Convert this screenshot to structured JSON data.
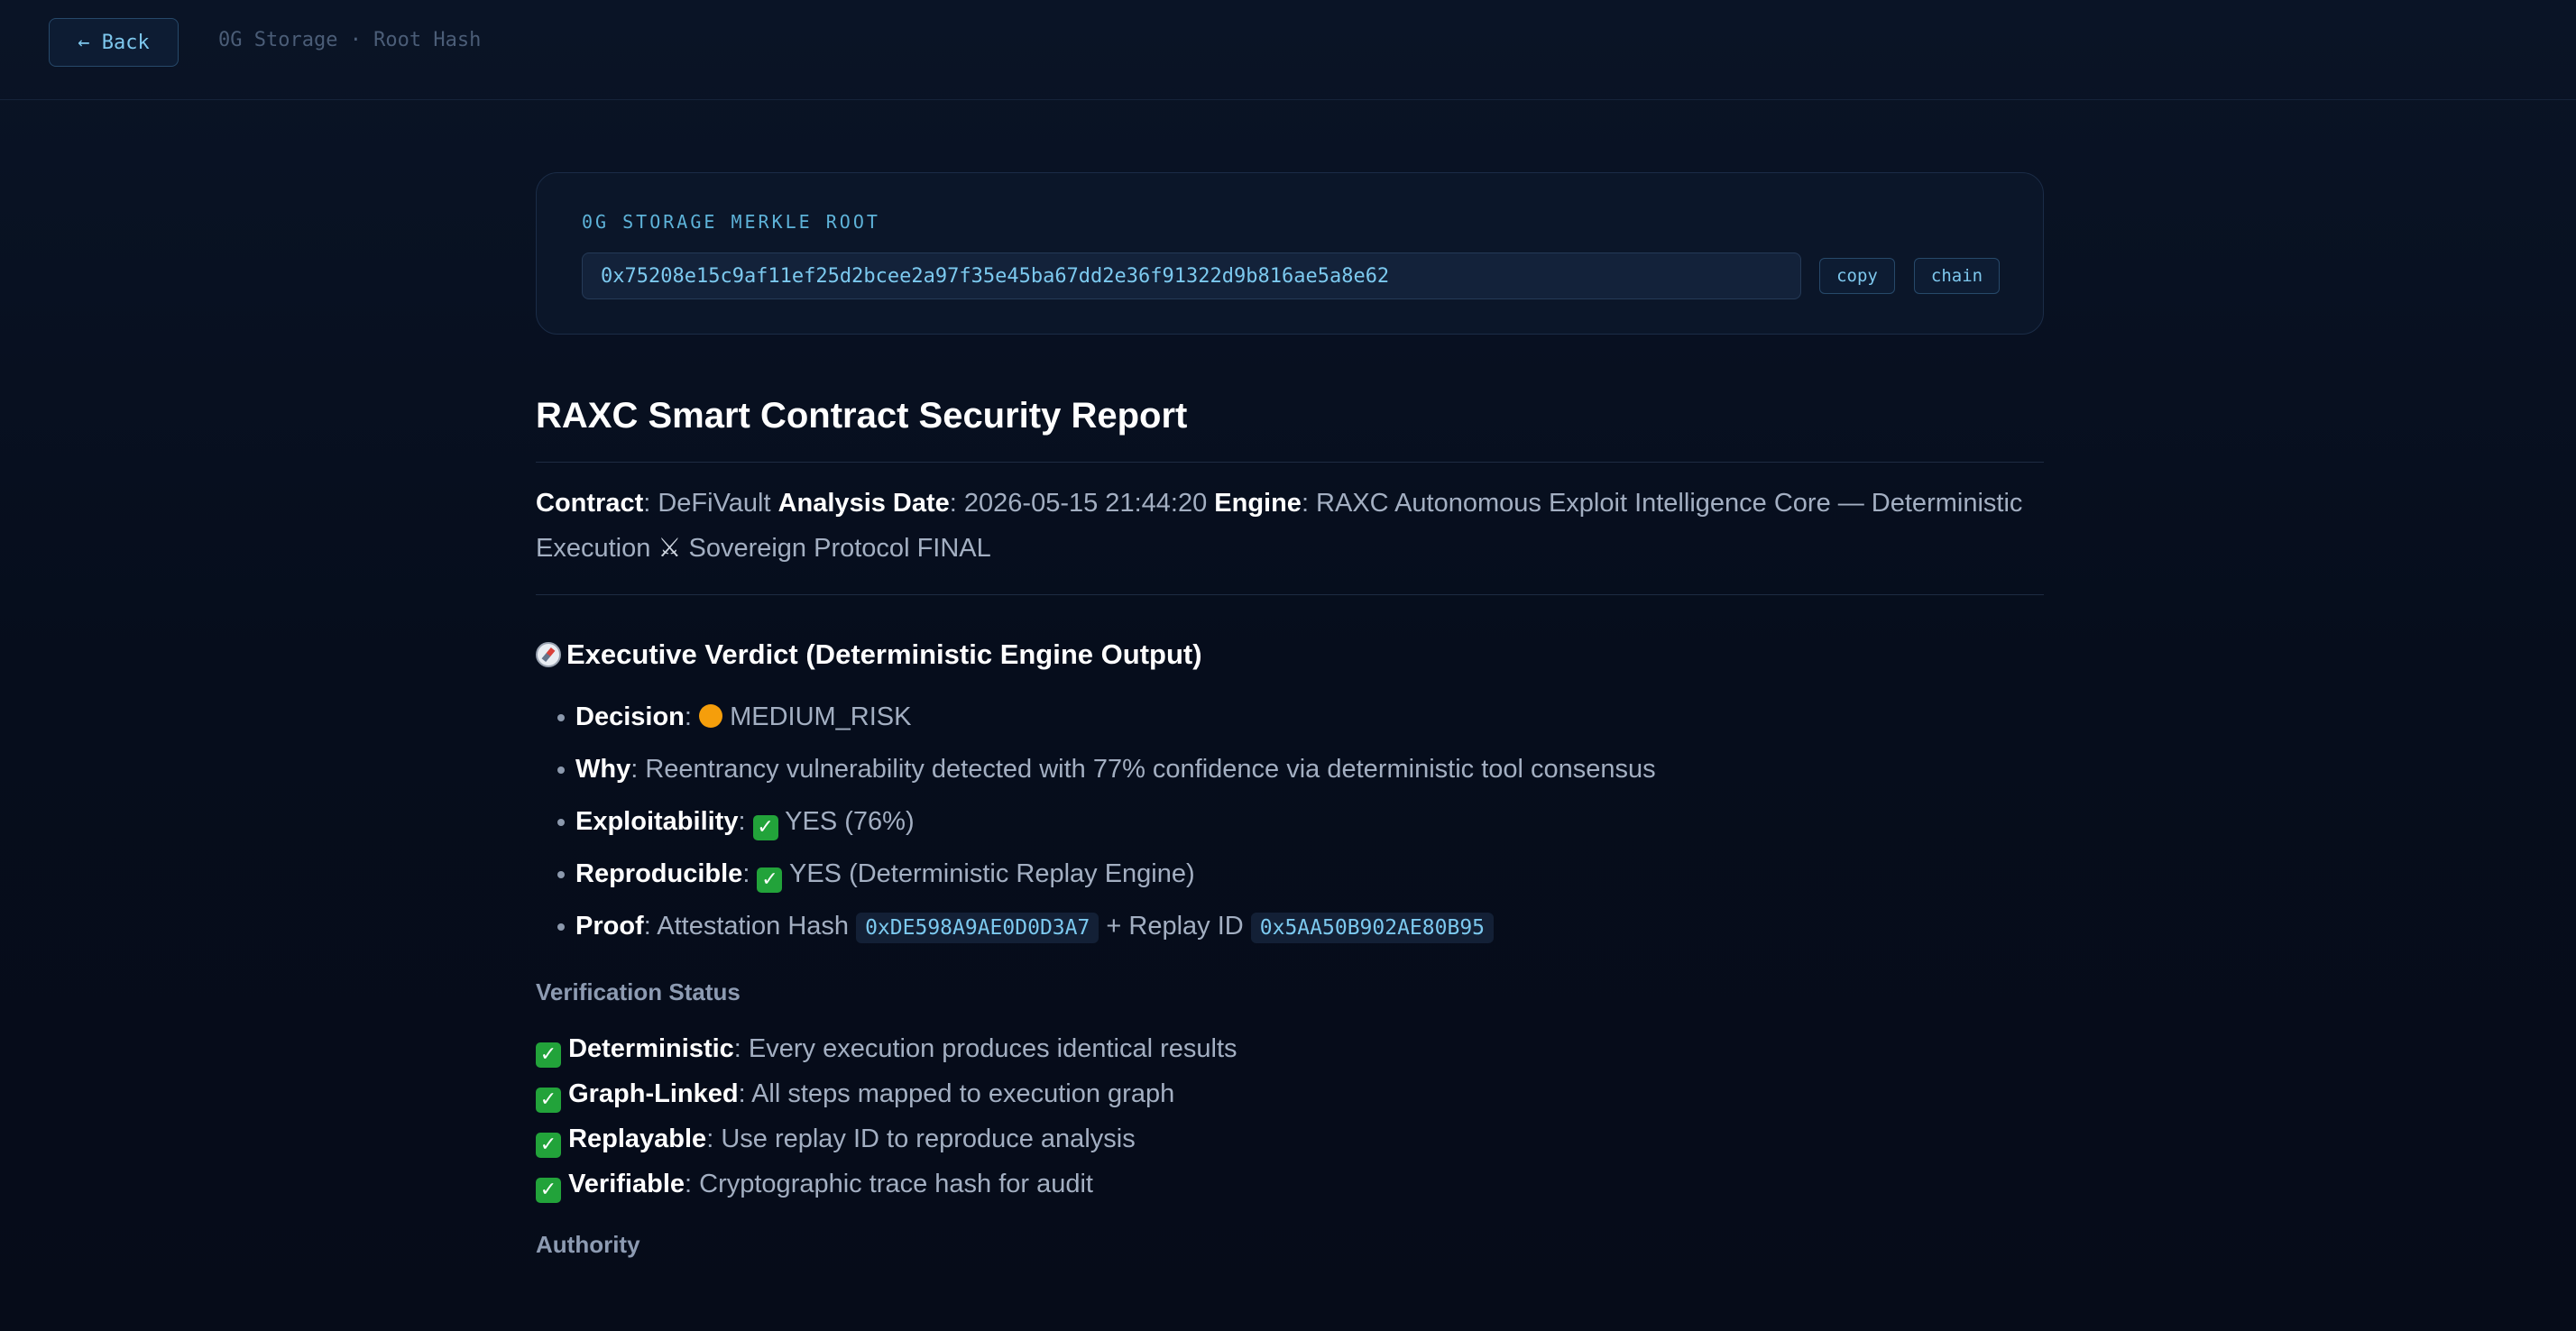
{
  "topbar": {
    "back_label": "← Back",
    "breadcrumb": "0G Storage · Root Hash"
  },
  "card": {
    "label": "0G STORAGE MERKLE ROOT",
    "hash": "0x75208e15c9af11ef25d2bcee2a97f35e45ba67dd2e36f91322d9b816ae5a8e62",
    "copy_label": "copy",
    "chain_label": "chain"
  },
  "report": {
    "title": "RAXC Smart Contract Security Report",
    "meta": {
      "contract_key": "Contract",
      "contract_value": ": DeFiVault ",
      "date_key": "Analysis Date",
      "date_value": ": 2026-05-15 21:44:20 ",
      "engine_key": "Engine",
      "engine_value_1": ": RAXC Autonomous Exploit Intelligence Core — Deterministic Execution ",
      "engine_glyph": "⚔",
      "engine_value_2": " Sovereign Protocol FINAL"
    },
    "verdict": {
      "title": "Executive Verdict (Deterministic Engine Output)",
      "decision_key": "Decision",
      "decision_value": "MEDIUM_RISK",
      "why_key": "Why",
      "why_value": ": Reentrancy vulnerability detected with 77% confidence via deterministic tool consensus",
      "exploit_key": "Exploitability",
      "exploit_value": "YES (76%)",
      "repro_key": "Reproducible",
      "repro_value": "YES (Deterministic Replay Engine)",
      "proof_key": "Proof",
      "proof_text_1": ": Attestation Hash ",
      "attestation_hash": "0xDE598A9AE0D0D3A7",
      "proof_text_2": " + Replay ID ",
      "replay_id": "0x5AA50B902AE80B95"
    },
    "verification": {
      "title": "Verification Status",
      "items": [
        {
          "key": "Deterministic",
          "value": ": Every execution produces identical results"
        },
        {
          "key": "Graph-Linked",
          "value": ": All steps mapped to execution graph"
        },
        {
          "key": "Replayable",
          "value": ": Use replay ID to reproduce analysis"
        },
        {
          "key": "Verifiable",
          "value": ": Cryptographic trace hash for audit"
        }
      ]
    },
    "authority_title": "Authority"
  },
  "colors": {
    "background": "#070f1f",
    "accent": "#7cc9ef",
    "check_green": "#22a33a",
    "medium_risk_orange": "#f59e0b"
  }
}
